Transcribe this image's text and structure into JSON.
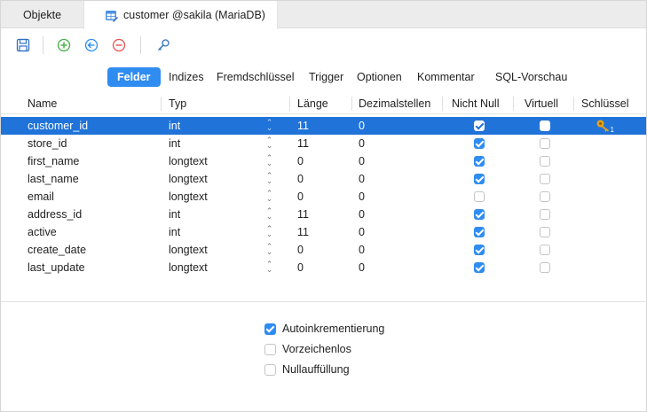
{
  "tabs": {
    "objects": "Objekte",
    "customer": "customer @sakila (MariaDB)"
  },
  "toolbar": {
    "buttons": [
      "save-icon",
      "add-field-icon",
      "insert-field-icon",
      "delete-field-icon",
      "key-icon"
    ]
  },
  "subtabs": {
    "felder": "Felder",
    "indizes": "Indizes",
    "fremdschluessel": "Fremdschlüssel",
    "trigger": "Trigger",
    "optionen": "Optionen",
    "kommentar": "Kommentar",
    "sqlvorschau": "SQL-Vorschau"
  },
  "columns": {
    "name": "Name",
    "typ": "Typ",
    "laenge": "Länge",
    "dezimal": "Dezimalstellen",
    "nichtnull": "Nicht Null",
    "virtuell": "Virtuell",
    "schluessel": "Schlüssel"
  },
  "rows": [
    {
      "name": "customer_id",
      "typ": "int",
      "laenge": "11",
      "dezimal": "0",
      "nichtnull": true,
      "virtuell": false,
      "key": "1",
      "selected": true
    },
    {
      "name": "store_id",
      "typ": "int",
      "laenge": "11",
      "dezimal": "0",
      "nichtnull": true,
      "virtuell": false,
      "key": "",
      "selected": false
    },
    {
      "name": "first_name",
      "typ": "longtext",
      "laenge": "0",
      "dezimal": "0",
      "nichtnull": true,
      "virtuell": false,
      "key": "",
      "selected": false
    },
    {
      "name": "last_name",
      "typ": "longtext",
      "laenge": "0",
      "dezimal": "0",
      "nichtnull": true,
      "virtuell": false,
      "key": "",
      "selected": false
    },
    {
      "name": "email",
      "typ": "longtext",
      "laenge": "0",
      "dezimal": "0",
      "nichtnull": false,
      "virtuell": false,
      "key": "",
      "selected": false
    },
    {
      "name": "address_id",
      "typ": "int",
      "laenge": "11",
      "dezimal": "0",
      "nichtnull": true,
      "virtuell": false,
      "key": "",
      "selected": false
    },
    {
      "name": "active",
      "typ": "int",
      "laenge": "11",
      "dezimal": "0",
      "nichtnull": true,
      "virtuell": false,
      "key": "",
      "selected": false
    },
    {
      "name": "create_date",
      "typ": "longtext",
      "laenge": "0",
      "dezimal": "0",
      "nichtnull": true,
      "virtuell": false,
      "key": "",
      "selected": false
    },
    {
      "name": "last_update",
      "typ": "longtext",
      "laenge": "0",
      "dezimal": "0",
      "nichtnull": true,
      "virtuell": false,
      "key": "",
      "selected": false
    }
  ],
  "options": [
    {
      "label": "Autoinkrementierung",
      "checked": true
    },
    {
      "label": "Vorzeichenlos",
      "checked": false
    },
    {
      "label": "Nullauffüllung",
      "checked": false
    }
  ],
  "colors": {
    "accent": "#2f8cf0",
    "selection": "#1f73d9",
    "add": "#3fae3f",
    "insert": "#2f8cf0",
    "delete": "#e35050",
    "key": "#e8a317"
  }
}
